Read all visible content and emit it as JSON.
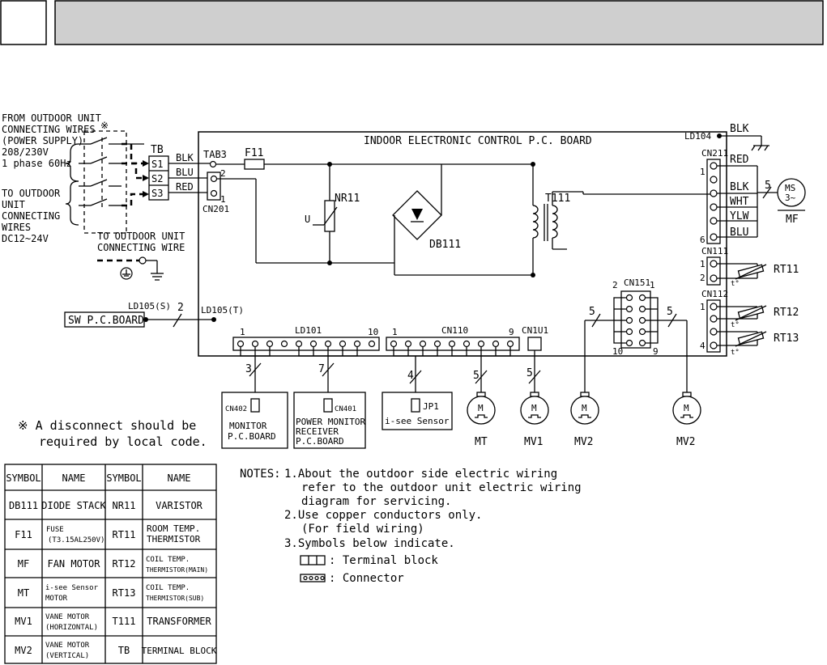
{
  "title_bar": {
    "number": "",
    "title": ""
  },
  "pcb": {
    "title": "INDOOR ELECTRONIC CONTROL P.C. BOARD"
  },
  "left": {
    "from_outdoor": [
      "FROM OUTDOOR UNIT",
      "CONNECTING WIRES",
      "(POWER SUPPLY)",
      "208/230V",
      "1 phase 60Hz"
    ],
    "to_outdoor": [
      "TO OUTDOOR",
      "UNIT",
      "CONNECTING",
      "WIRES",
      "DC12~24V"
    ],
    "ground": [
      "TO OUTDOOR UNIT",
      "CONNECTING WIRE"
    ],
    "mark": "※",
    "tb": "TB",
    "terminals": [
      "S1",
      "S2",
      "S3"
    ],
    "wire_colors": [
      "BLK",
      "BLU",
      "RED"
    ]
  },
  "labels": {
    "tab3": "TAB3",
    "f11": "F11",
    "cn201": "CN201",
    "pin2": "2",
    "pin1": "1",
    "nr11": "NR11",
    "u": "U",
    "db111": "DB111",
    "t111": "T111",
    "ld104": "LD104",
    "blk_top": "BLK",
    "cn211": "CN211",
    "cn211_colors": [
      "RED",
      "BLK",
      "WHT",
      "YLW",
      "BLU"
    ],
    "cn211_pins": [
      "1",
      "6"
    ],
    "five": "5",
    "ms": [
      "MS",
      "3~"
    ],
    "mf": "MF",
    "cn111": "CN111",
    "cn111_pins": [
      "1",
      "2"
    ],
    "rt11": "RT11",
    "cn112": "CN112",
    "cn112_pins": [
      "1",
      "4"
    ],
    "rt12": "RT12",
    "rt13": "RT13",
    "tdeg": "t°",
    "cn151": "CN151",
    "cn151_pins": [
      "2",
      "1",
      "10",
      "9"
    ],
    "ld105s": "LD105(S)",
    "ld105t": "LD105(T)",
    "sw_board": "SW P.C.BOARD",
    "two": "2",
    "ld101": "LD101",
    "ld101_pins": [
      "1",
      "10"
    ],
    "cn110": "CN110",
    "cn110_pins": [
      "1",
      "9"
    ],
    "cn1u1": "CN1U1",
    "counts": [
      "3",
      "7",
      "4",
      "5",
      "5",
      "5",
      "5"
    ],
    "cn402": "CN402",
    "cn402_name": [
      "MONITOR",
      "P.C.BOARD"
    ],
    "cn401": "CN401",
    "cn401_name": [
      "POWER MONITOR",
      "RECEIVER",
      "P.C.BOARD"
    ],
    "jp1": "JP1",
    "jp1_name": "i-see Sensor",
    "motor_m": "M",
    "motors": [
      "MT",
      "MV1",
      "MV2",
      "MV2"
    ],
    "disconnect": [
      "※ A disconnect should be",
      "required by local code."
    ]
  },
  "symbol_table": {
    "headers": [
      "SYMBOL",
      "NAME",
      "SYMBOL",
      "NAME"
    ],
    "rows": [
      {
        "s1": "DB111",
        "n1": [
          "DIODE STACK"
        ],
        "s2": "NR11",
        "n2": [
          "VARISTOR"
        ]
      },
      {
        "s1": "F11",
        "n1": [
          "FUSE",
          "(T3.15AL250V)"
        ],
        "s2": "RT11",
        "n2": [
          "ROOM TEMP.",
          "THERMISTOR"
        ]
      },
      {
        "s1": "MF",
        "n1": [
          "FAN MOTOR"
        ],
        "s2": "RT12",
        "n2": [
          "COIL TEMP.",
          "THERMISTOR(MAIN)"
        ]
      },
      {
        "s1": "MT",
        "n1": [
          "i-see Sensor",
          "MOTOR"
        ],
        "s2": "RT13",
        "n2": [
          "COIL TEMP.",
          "THERMISTOR(SUB)"
        ]
      },
      {
        "s1": "MV1",
        "n1": [
          "VANE MOTOR",
          "(HORIZONTAL)"
        ],
        "s2": "T111",
        "n2": [
          "TRANSFORMER"
        ]
      },
      {
        "s1": "MV2",
        "n1": [
          "VANE MOTOR",
          "(VERTICAL)"
        ],
        "s2": "TB",
        "n2": [
          "TERMINAL BLOCK"
        ]
      }
    ]
  },
  "notes": {
    "header": "NOTES:",
    "lines": [
      "1.About the outdoor side electric wiring",
      "refer to the outdoor unit electric wiring",
      "diagram for servicing.",
      "2.Use copper conductors only.",
      "(For field wiring)",
      "3.Symbols below indicate.",
      ": Terminal block",
      ": Connector"
    ]
  }
}
